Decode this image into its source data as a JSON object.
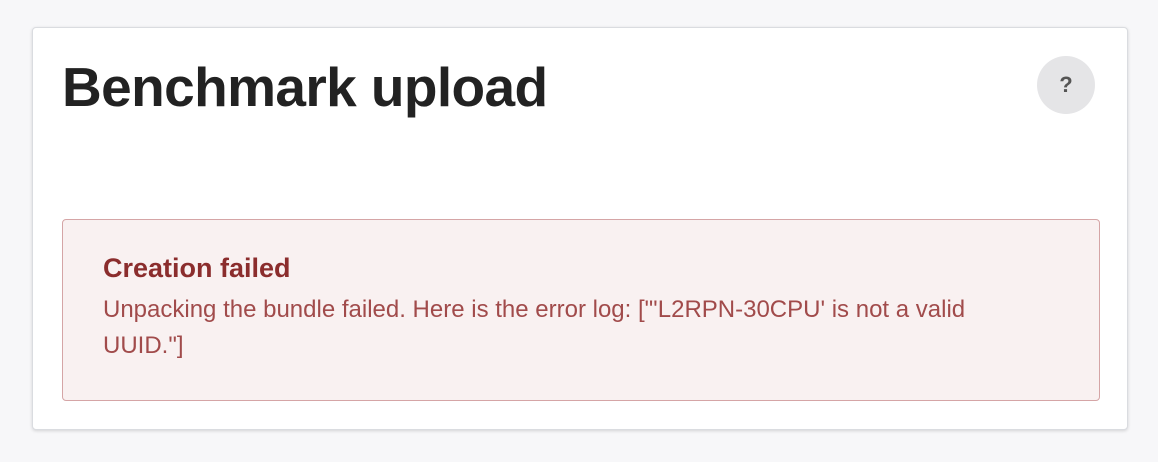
{
  "page": {
    "title": "Benchmark upload"
  },
  "help": {
    "label": "?",
    "icon": "question-mark-icon"
  },
  "alert": {
    "title": "Creation failed",
    "message": "Unpacking the bundle failed. Here is the error log: [\"'L2RPN-30CPU' is not a valid UUID.\"]"
  },
  "colors": {
    "alert_background": "#f9f1f1",
    "alert_border": "#d5a5a6",
    "alert_title": "#8b2d2d",
    "alert_text": "#a14b4b",
    "help_button_background": "#e5e5e7"
  }
}
